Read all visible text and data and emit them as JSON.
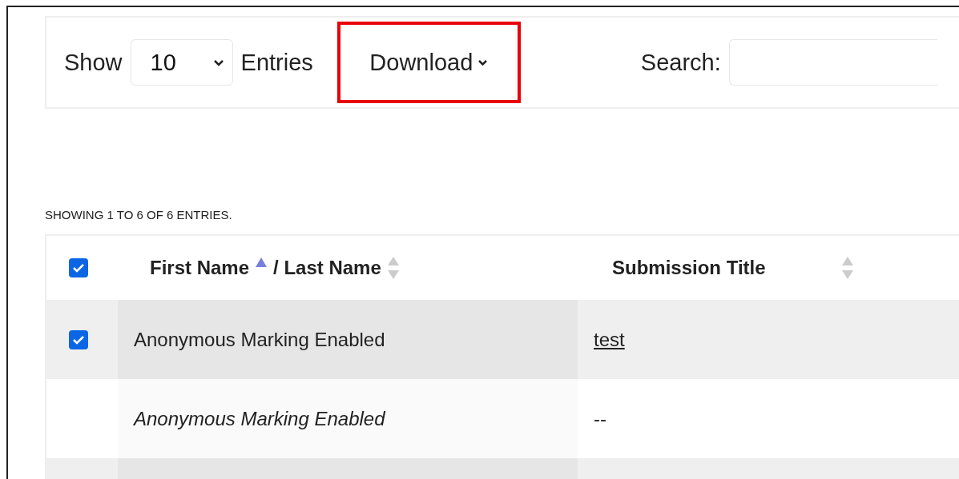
{
  "toolbar": {
    "show_label": "Show",
    "page_size": "10",
    "entries_label": "Entries",
    "download": {
      "label": "Download",
      "highlighted": true
    },
    "search_label": "Search:"
  },
  "summary": "SHOWING 1 TO 6 OF 6 ENTRIES.",
  "table": {
    "select_all_checked": true,
    "columns": [
      {
        "parts": [
          {
            "label": "First Name",
            "sorted": true
          },
          {
            "label": "/ Last Name",
            "sorted": false
          }
        ]
      },
      {
        "parts": [
          {
            "label": "Submission Title",
            "sorted": false
          }
        ]
      }
    ],
    "rows": [
      {
        "kind": "submission",
        "checked": true,
        "name": "Anonymous Marking Enabled",
        "title": "test",
        "link": true
      },
      {
        "kind": "member",
        "name": "Anonymous Marking Enabled",
        "title": "--",
        "link": false
      },
      {
        "kind": "blank"
      }
    ]
  }
}
